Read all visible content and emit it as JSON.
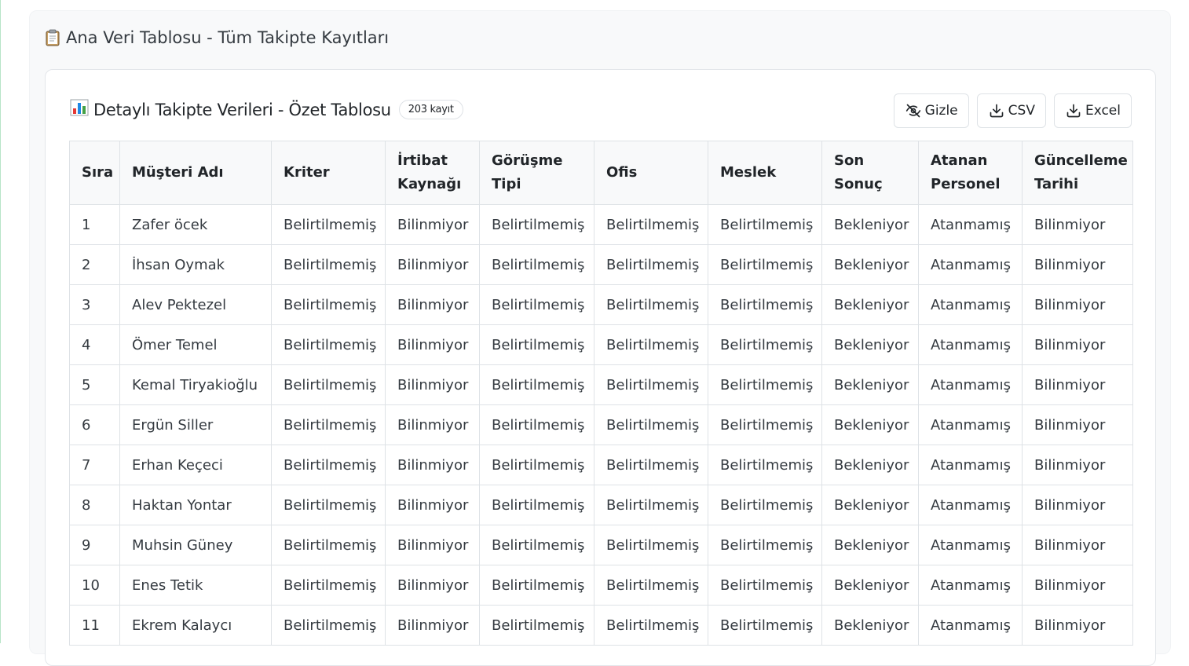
{
  "main": {
    "title": "Ana Veri Tablosu - Tüm Takipte Kayıtları"
  },
  "panel": {
    "title": "Detaylı Takipte Verileri - Özet Tablosu",
    "badge": "203 kayıt",
    "buttons": {
      "hide": "Gizle",
      "csv": "CSV",
      "excel": "Excel"
    }
  },
  "table": {
    "headers": [
      "Sıra",
      "Müşteri Adı",
      "Kriter",
      "İrtibat Kaynağı",
      "Görüşme Tipi",
      "Ofis",
      "Meslek",
      "Son Sonuç",
      "Atanan Personel",
      "Güncelleme Tarihi"
    ],
    "rows": [
      [
        "1",
        "Zafer öcek",
        "Belirtilmemiş",
        "Bilinmiyor",
        "Belirtilmemiş",
        "Belirtilmemiş",
        "Belirtilmemiş",
        "Bekleniyor",
        "Atanmamış",
        "Bilinmiyor"
      ],
      [
        "2",
        "İhsan Oymak",
        "Belirtilmemiş",
        "Bilinmiyor",
        "Belirtilmemiş",
        "Belirtilmemiş",
        "Belirtilmemiş",
        "Bekleniyor",
        "Atanmamış",
        "Bilinmiyor"
      ],
      [
        "3",
        "Alev Pektezel",
        "Belirtilmemiş",
        "Bilinmiyor",
        "Belirtilmemiş",
        "Belirtilmemiş",
        "Belirtilmemiş",
        "Bekleniyor",
        "Atanmamış",
        "Bilinmiyor"
      ],
      [
        "4",
        "Ömer Temel",
        "Belirtilmemiş",
        "Bilinmiyor",
        "Belirtilmemiş",
        "Belirtilmemiş",
        "Belirtilmemiş",
        "Bekleniyor",
        "Atanmamış",
        "Bilinmiyor"
      ],
      [
        "5",
        "Kemal Tiryakioğlu",
        "Belirtilmemiş",
        "Bilinmiyor",
        "Belirtilmemiş",
        "Belirtilmemiş",
        "Belirtilmemiş",
        "Bekleniyor",
        "Atanmamış",
        "Bilinmiyor"
      ],
      [
        "6",
        "Ergün Siller",
        "Belirtilmemiş",
        "Bilinmiyor",
        "Belirtilmemiş",
        "Belirtilmemiş",
        "Belirtilmemiş",
        "Bekleniyor",
        "Atanmamış",
        "Bilinmiyor"
      ],
      [
        "7",
        "Erhan Keçeci",
        "Belirtilmemiş",
        "Bilinmiyor",
        "Belirtilmemiş",
        "Belirtilmemiş",
        "Belirtilmemiş",
        "Bekleniyor",
        "Atanmamış",
        "Bilinmiyor"
      ],
      [
        "8",
        "Haktan Yontar",
        "Belirtilmemiş",
        "Bilinmiyor",
        "Belirtilmemiş",
        "Belirtilmemiş",
        "Belirtilmemiş",
        "Bekleniyor",
        "Atanmamış",
        "Bilinmiyor"
      ],
      [
        "9",
        "Muhsin Güney",
        "Belirtilmemiş",
        "Bilinmiyor",
        "Belirtilmemiş",
        "Belirtilmemiş",
        "Belirtilmemiş",
        "Bekleniyor",
        "Atanmamış",
        "Bilinmiyor"
      ],
      [
        "10",
        "Enes Tetik",
        "Belirtilmemiş",
        "Bilinmiyor",
        "Belirtilmemiş",
        "Belirtilmemiş",
        "Belirtilmemiş",
        "Bekleniyor",
        "Atanmamış",
        "Bilinmiyor"
      ],
      [
        "11",
        "Ekrem Kalaycı",
        "Belirtilmemiş",
        "Bilinmiyor",
        "Belirtilmemiş",
        "Belirtilmemiş",
        "Belirtilmemiş",
        "Bekleniyor",
        "Atanmamış",
        "Bilinmiyor"
      ]
    ]
  },
  "icons": {
    "main_title": "clipboard-icon",
    "panel_title": "bar-chart-icon",
    "hide": "eye-slash-icon",
    "csv": "download-icon",
    "excel": "download-icon"
  },
  "colors": {
    "accent_border": "#b7e4c7",
    "header_bg": "#f8f9fa",
    "border": "#dee2e6"
  }
}
